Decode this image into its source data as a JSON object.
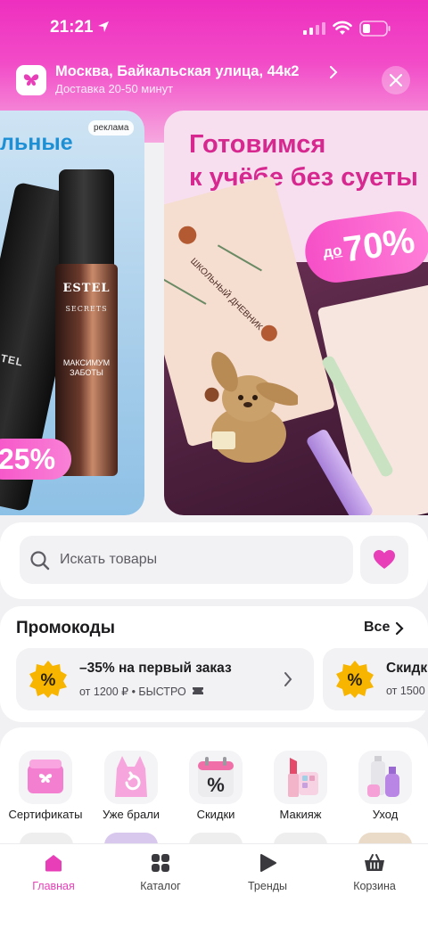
{
  "status_bar": {
    "time": "21:21"
  },
  "address": {
    "title": "Москва, Байкальская улица, 44к2",
    "subtitle": "Доставка 20-50 минут"
  },
  "banners": {
    "left": {
      "title": "льные",
      "ad_label": "реклама",
      "tube_text": "ESTEL",
      "tube_sub": "SECRETS",
      "bottle_brand": "ESTEL",
      "bottle_line": "SECRETS",
      "bottle_name": "МАКСИМУМ ЗАБОТЫ",
      "discount": "25%"
    },
    "right": {
      "title_line1": "Готовимся",
      "title_line2": "к учёбе без суеты",
      "discount_prefix": "до",
      "discount": "70%",
      "notebook_text": "ШКОЛЬНЫЙ ДНЕВНИК"
    }
  },
  "search": {
    "placeholder": "Искать товары"
  },
  "promo": {
    "title": "Промокоды",
    "all_label": "Все",
    "items": [
      {
        "main": "–35% на первый заказ",
        "sub": "от 1200 ₽ • БЫСТРО"
      },
      {
        "main": "Скидк",
        "sub": "от 1500"
      }
    ]
  },
  "categories": [
    {
      "label": "Сертификаты",
      "icon": "gift-card-icon"
    },
    {
      "label": "Уже брали",
      "icon": "repeat-bag-icon"
    },
    {
      "label": "Скидки",
      "icon": "calendar-percent-icon"
    },
    {
      "label": "Макияж",
      "icon": "lipstick-icon"
    },
    {
      "label": "Уход",
      "icon": "cosmetics-bottles-icon"
    }
  ],
  "tabs": [
    {
      "label": "Главная",
      "icon": "home-icon",
      "active": true
    },
    {
      "label": "Каталог",
      "icon": "catalog-icon",
      "active": false
    },
    {
      "label": "Тренды",
      "icon": "play-icon",
      "active": false
    },
    {
      "label": "Корзина",
      "icon": "basket-icon",
      "active": false
    }
  ],
  "colors": {
    "brand_pink": "#ee2fbf",
    "accent_pink": "#e83fb9",
    "promo_yellow": "#f7b500"
  }
}
